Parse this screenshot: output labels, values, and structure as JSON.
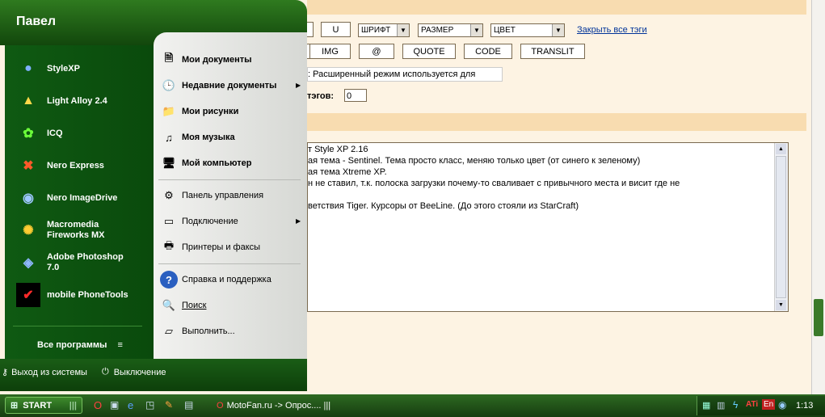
{
  "forum": {
    "toolbar1": {
      "u": "U",
      "font": "ШРИФТ",
      "size": "РАЗМЕР",
      "color": "ЦВЕТ",
      "close_tags": "Закрыть все тэги"
    },
    "toolbar2": {
      "img": "IMG",
      "at": "@",
      "quote": "QUOTE",
      "code": "CODE",
      "translit": "TRANSLIT"
    },
    "hint": ": Расширенный режим используется для",
    "tags_label": "тэгов:",
    "tags_value": "0",
    "text_lines": [
      "т Style XP 2.16",
      "ая тема -  Sentinel. Тема просто класс, меняю только цвет (от синего к зеленому)",
      "ая тема Xtreme XP.",
      "н не ставил, т.к. полоска загрузки почему-то сваливает с привычного места и висит где не",
      "",
      "ветствия Tiger. Курсоры от BeeLine. (До этого стояли из StarCraft)"
    ]
  },
  "startmenu": {
    "user": "Павел",
    "programs": [
      {
        "label": "StyleXP",
        "icon": "bubbles-icon",
        "color": "#7fb0ff"
      },
      {
        "label": "Light Alloy 2.4",
        "icon": "triangle-icon",
        "color": "#ffd84a"
      },
      {
        "label": "ICQ",
        "icon": "flower-icon",
        "color": "#6cff3a"
      },
      {
        "label": "Nero Express",
        "icon": "nero-icon",
        "color": "#ff5a2a"
      },
      {
        "label": "Nero ImageDrive",
        "icon": "disc-icon",
        "color": "#9ec8ff"
      },
      {
        "label": "Macromedia",
        "label2": "Fireworks MX",
        "icon": "fireworks-icon",
        "color": "#ffcc33"
      },
      {
        "label": "Adobe Photoshop",
        "label2": "7.0",
        "icon": "photoshop-icon",
        "color": "#8fb8ff"
      },
      {
        "label": "mobile PhoneTools",
        "icon": "verizon-icon",
        "color": "#ff2a2a"
      }
    ],
    "all_programs": "Все программы",
    "places": [
      {
        "label": "Мои документы",
        "icon": "documents-icon"
      },
      {
        "label": "Недавние документы",
        "icon": "recent-docs-icon"
      },
      {
        "label": "Мои рисунки",
        "icon": "pictures-folder-icon"
      },
      {
        "label": "Моя музыка",
        "icon": "music-folder-icon"
      },
      {
        "label": "Мой компьютер",
        "icon": "computer-icon"
      },
      {
        "label": "Панель управления",
        "icon": "control-panel-icon"
      },
      {
        "label": "Подключение",
        "icon": "network-icon"
      },
      {
        "label": "Принтеры и факсы",
        "icon": "printer-icon"
      },
      {
        "label": "Справка и поддержка",
        "icon": "help-icon"
      },
      {
        "label": "Поиск",
        "icon": "search-icon"
      },
      {
        "label": "Выполнить...",
        "icon": "run-icon"
      }
    ],
    "logoff": "Выход из системы",
    "shutdown": "Выключение"
  },
  "taskbar": {
    "start": "START",
    "task": "MotoFan.ru -> Опрос.... |||",
    "tray_lang": "En",
    "clock": "1:13"
  },
  "colors": {
    "accent_green": "#1d5e16",
    "page_bg": "#fdf3e3",
    "band": "#f8dcb0"
  }
}
